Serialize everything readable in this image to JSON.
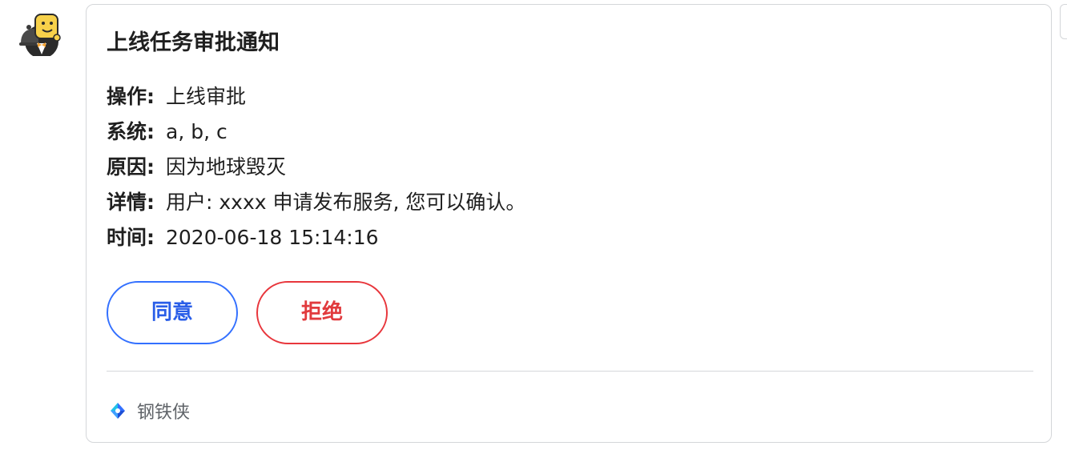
{
  "card": {
    "title": "上线任务审批通知",
    "fields": [
      {
        "label": "操作:",
        "value": "上线审批"
      },
      {
        "label": "系统:",
        "value": "a, b, c"
      },
      {
        "label": "原因:",
        "value": "因为地球毁灭"
      },
      {
        "label": "详情:",
        "value": "用户: xxxx 申请发布服务, 您可以确认。"
      },
      {
        "label": "时间:",
        "value": "2020-06-18 15:14:16"
      }
    ],
    "buttons": {
      "approve_label": "同意",
      "reject_label": "拒绝"
    },
    "footer": {
      "source_name": "钢铁侠",
      "icon": "app-logo-icon"
    }
  },
  "sender": {
    "avatar_icon": "bot-avatar-icon"
  },
  "colors": {
    "approve": "#3370ff",
    "reject": "#e8363c",
    "border": "#d4d6d9"
  }
}
